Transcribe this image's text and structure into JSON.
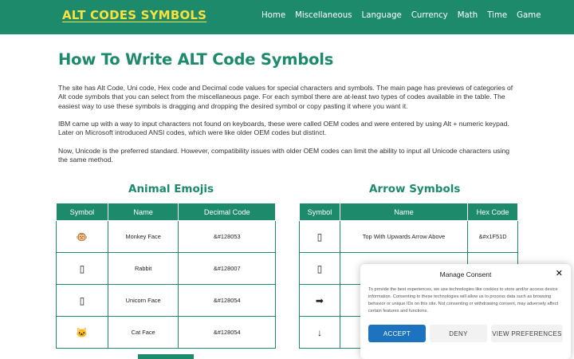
{
  "header": {
    "logo": "ALT CODES SYMBOLS",
    "nav": [
      "Home",
      "Miscellaneous",
      "Language",
      "Currency",
      "Math",
      "Time",
      "Game"
    ]
  },
  "main": {
    "title": "How To Write ALT Code Symbols",
    "paragraphs": [
      "The site has Alt Code, Uni code, Hex code and Decimal code values for special characters and symbols. The main page has previews of categories of Alt code symbols that you can select from the miscellaneous page. For each symbol there are at-least two types of codes available in the table. The easiest way to use these symbols is dragging and dropping the desired symbol or copy pasting it where you want it.",
      "IBM came up with a way to input characters not found on keyboards, these were called OEM codes and were entered by using Alt + numeric keypad. Later on Microsoft introduced ANSI codes, which were like older OEM codes but distinct.",
      "Now, Unicode is the preferred standard. However, compatibility issues with older OEM codes can limit the ability to input all Unicode characters using the same method."
    ]
  },
  "animal_table": {
    "title": "Animal Emojis",
    "headers": [
      "Symbol",
      "Name",
      "Decimal Code"
    ],
    "rows": [
      {
        "symbol": "🐵",
        "name": "Monkey Face",
        "code": "&#128053"
      },
      {
        "symbol": "▯",
        "name": "Rabbit",
        "code": "&#128007"
      },
      {
        "symbol": "▯",
        "name": "Unicorn Face",
        "code": "&#128054"
      },
      {
        "symbol": "🐱",
        "name": "Cat Face",
        "code": "&#128054"
      }
    ]
  },
  "arrow_table": {
    "title": "Arrow Symbols",
    "headers": [
      "Symbol",
      "Name",
      "Hex Code"
    ],
    "rows": [
      {
        "symbol": "▯",
        "name": "Top With Upwards Arrow Above",
        "code": "&#x1F51D"
      },
      {
        "symbol": "▯",
        "name": "",
        "code": ""
      },
      {
        "symbol": "➡",
        "name": "",
        "code": ""
      },
      {
        "symbol": "↓",
        "name": "",
        "code": ""
      }
    ]
  },
  "consent": {
    "title": "Manage Consent",
    "close": "✕",
    "text": "To provide the best experiences, we use technologies like cookies to store and/or access device information. Consenting to these technologies will allow us to process data such as browsing behavior or unique IDs on this site. Not consenting or withdrawing consent, may adversely affect certain features and functions.",
    "accept": "ACCEPT",
    "deny": "DENY",
    "preferences": "VIEW PREFERENCES"
  },
  "colors": {
    "brand_green": "#1e8a6c",
    "logo_yellow": "#f7e23e",
    "accept_blue": "#1e73be"
  }
}
